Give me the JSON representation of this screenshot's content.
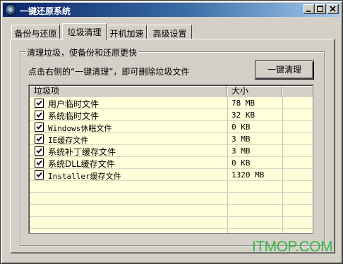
{
  "window": {
    "title": "一键还原系统"
  },
  "tabs": [
    {
      "label": "备份与还原",
      "active": false
    },
    {
      "label": "垃圾清理",
      "active": true
    },
    {
      "label": "开机加速",
      "active": false
    },
    {
      "label": "高级设置",
      "active": false
    }
  ],
  "cleanup": {
    "group_title": "清理垃圾，使备份和还原更快",
    "hint": "点击右侧的“一键清理”，即可删除垃圾文件",
    "button_label": "一键清理",
    "columns": {
      "item": "垃圾项",
      "size": "大小"
    },
    "rows": [
      {
        "name": "用户临时文件",
        "size": "78 MB",
        "checked": true
      },
      {
        "name": "系统临时文件",
        "size": "32 KB",
        "checked": true
      },
      {
        "name": "Windows休眠文件",
        "size": "0 KB",
        "checked": true
      },
      {
        "name": "IE缓存文件",
        "size": "3 MB",
        "checked": true
      },
      {
        "name": "系统补丁缓存文件",
        "size": "3 MB",
        "checked": true
      },
      {
        "name": "系统DLL缓存文件",
        "size": "0 KB",
        "checked": true
      },
      {
        "name": "Installer缓存文件",
        "size": "1320 MB",
        "checked": true
      }
    ]
  },
  "watermark": "ITMOP.COM"
}
